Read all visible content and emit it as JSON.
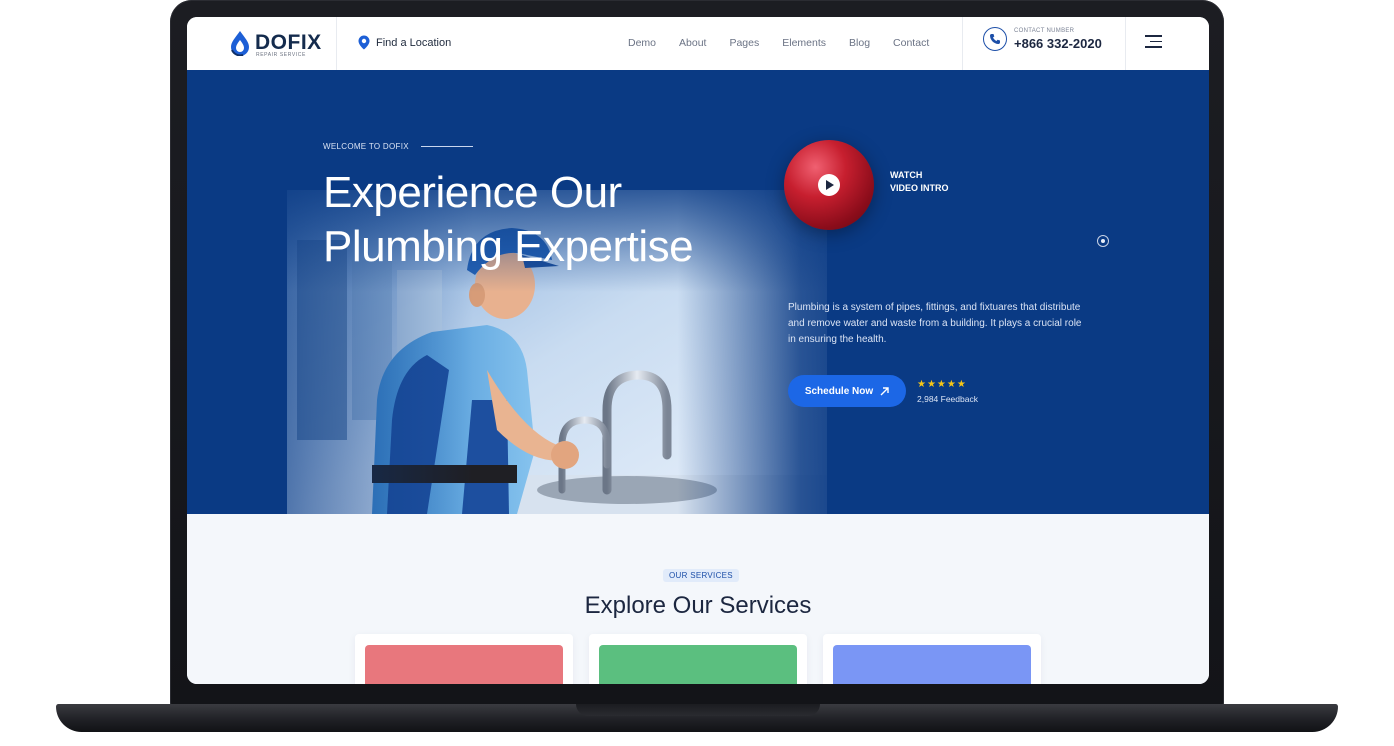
{
  "header": {
    "logo_name": "DOFIX",
    "logo_tagline": "REPAIR SERVICE",
    "location_label": "Find a Location",
    "nav": [
      "Demo",
      "About",
      "Pages",
      "Elements",
      "Blog",
      "Contact"
    ],
    "contact_label": "CONTACT NUMBER",
    "contact_number": "+866 332-2020"
  },
  "hero": {
    "eyebrow": "WELCOME TO DOFIX",
    "title_line1": "Experience Our",
    "title_line2": "Plumbing Expertise",
    "video_line1": "WATCH",
    "video_line2": "VIDEO INTRO",
    "description": "Plumbing is a system of pipes, fittings, and fixtuares that distribute and remove water and waste from a building. It plays a crucial role in ensuring the health.",
    "cta_label": "Schedule Now",
    "rating_stars": 5,
    "stars": "★★★★★",
    "feedback": "2,984 Feedback"
  },
  "services": {
    "badge": "OUR SERVICES",
    "title": "Explore Our Services"
  },
  "colors": {
    "brand_blue": "#0a3a84",
    "accent_blue": "#1c67e6",
    "video_red": "#c71f2f",
    "star_yellow": "#f5c518",
    "card_red": "#e8777d",
    "card_green": "#5bbf7f",
    "card_blue": "#7a96f5"
  },
  "icons": {
    "logo": "water-drop-icon",
    "location": "map-pin-icon",
    "contact": "phone-icon",
    "menu": "hamburger-menu-icon",
    "video": "play-icon",
    "cta": "arrow-up-right-icon"
  }
}
